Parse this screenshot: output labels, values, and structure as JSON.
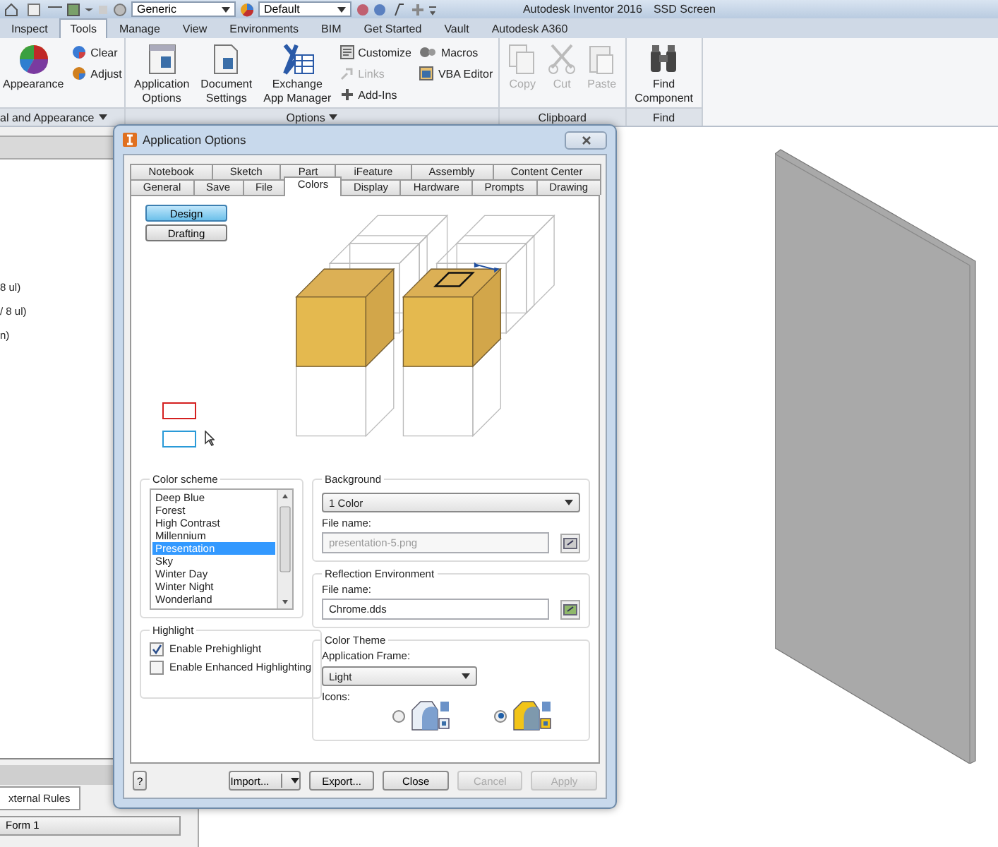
{
  "title_bar": {
    "style_dropdown": "Generic",
    "material_dropdown": "Default",
    "app_title": "Autodesk Inventor 2016",
    "document_title": "SSD Screen"
  },
  "ribbon": {
    "tabs": [
      {
        "label": "Inspect",
        "selected": false
      },
      {
        "label": "Tools",
        "selected": true
      },
      {
        "label": "Manage",
        "selected": false
      },
      {
        "label": "View",
        "selected": false
      },
      {
        "label": "Environments",
        "selected": false
      },
      {
        "label": "BIM",
        "selected": false
      },
      {
        "label": "Get Started",
        "selected": false
      },
      {
        "label": "Vault",
        "selected": false
      },
      {
        "label": "Autodesk A360",
        "selected": false
      }
    ],
    "groups": [
      {
        "label": "al and Appearance",
        "items": [
          {
            "kind": "large",
            "label": "Appearance",
            "disabled": false
          },
          {
            "kind": "small",
            "label": "Clear",
            "disabled": false
          },
          {
            "kind": "small",
            "label": "Adjust",
            "disabled": false
          }
        ]
      },
      {
        "label": "Options",
        "items": [
          {
            "kind": "large",
            "label": "Application\nOptions",
            "disabled": false
          },
          {
            "kind": "large",
            "label": "Document\nSettings",
            "disabled": false
          },
          {
            "kind": "large",
            "label": "Exchange\nApp Manager",
            "disabled": false
          },
          {
            "kind": "small",
            "label": "Customize",
            "disabled": false
          },
          {
            "kind": "small",
            "label": "Links",
            "disabled": true
          },
          {
            "kind": "small",
            "label": "Add-Ins",
            "disabled": false
          },
          {
            "kind": "small",
            "label": "Macros",
            "disabled": false
          },
          {
            "kind": "small",
            "label": "VBA Editor",
            "disabled": false
          }
        ]
      },
      {
        "label": "Clipboard",
        "items": [
          {
            "kind": "large",
            "label": "Copy",
            "disabled": true
          },
          {
            "kind": "large",
            "label": "Cut",
            "disabled": true
          },
          {
            "kind": "large",
            "label": "Paste",
            "disabled": true
          }
        ]
      },
      {
        "label": "Find",
        "items": [
          {
            "kind": "large",
            "label": "Find\nComponent",
            "disabled": false
          }
        ]
      }
    ]
  },
  "left_panel": {
    "lines": [
      "8 ul)",
      "/ 8 ul)",
      "n)"
    ],
    "tab": "xternal Rules",
    "button": "Form 1"
  },
  "dialog": {
    "title": "Application Options",
    "tab_rows": [
      [
        {
          "label": "Notebook",
          "selected": false
        },
        {
          "label": "Sketch",
          "selected": false
        },
        {
          "label": "Part",
          "selected": false
        },
        {
          "label": "iFeature",
          "selected": false
        },
        {
          "label": "Assembly",
          "selected": false
        },
        {
          "label": "Content Center",
          "selected": false
        }
      ],
      [
        {
          "label": "General",
          "selected": false
        },
        {
          "label": "Save",
          "selected": false
        },
        {
          "label": "File",
          "selected": false
        },
        {
          "label": "Colors",
          "selected": true
        },
        {
          "label": "Display",
          "selected": false
        },
        {
          "label": "Hardware",
          "selected": false
        },
        {
          "label": "Prompts",
          "selected": false
        },
        {
          "label": "Drawing",
          "selected": false
        }
      ]
    ],
    "modes": [
      {
        "label": "Design",
        "selected": true
      },
      {
        "label": "Drafting",
        "selected": false
      }
    ],
    "color_scheme": {
      "title": "Color scheme",
      "items": [
        {
          "label": "Deep Blue",
          "selected": false
        },
        {
          "label": "Forest",
          "selected": false
        },
        {
          "label": "High Contrast",
          "selected": false
        },
        {
          "label": "Millennium",
          "selected": false
        },
        {
          "label": "Presentation",
          "selected": true
        },
        {
          "label": "Sky",
          "selected": false
        },
        {
          "label": "Winter Day",
          "selected": false
        },
        {
          "label": "Winter Night",
          "selected": false
        },
        {
          "label": "Wonderland",
          "selected": false
        }
      ]
    },
    "background": {
      "title": "Background",
      "dropdown": "1 Color",
      "file_label": "File name:",
      "file_value": "presentation-5.png",
      "file_disabled": true
    },
    "reflection": {
      "title": "Reflection Environment",
      "file_label": "File name:",
      "file_value": "Chrome.dds",
      "file_disabled": false
    },
    "highlight": {
      "title": "Highlight",
      "options": [
        {
          "label": "Enable Prehighlight",
          "checked": true
        },
        {
          "label": "Enable Enhanced Highlighting",
          "checked": false
        }
      ]
    },
    "color_theme": {
      "title": "Color Theme",
      "frame_label": "Application Frame:",
      "frame_dropdown": "Light",
      "icons_label": "Icons:",
      "icon_options": [
        {
          "kind": "blue",
          "selected": false
        },
        {
          "kind": "yellow",
          "selected": true
        }
      ]
    },
    "help": "?",
    "buttons": [
      {
        "label": "Import...",
        "kind": "split",
        "disabled": false
      },
      {
        "label": "Export...",
        "kind": "plain",
        "disabled": false
      },
      {
        "label": "Close",
        "kind": "plain",
        "disabled": false
      },
      {
        "label": "Cancel",
        "kind": "plain",
        "disabled": true
      },
      {
        "label": "Apply",
        "kind": "plain",
        "disabled": true
      }
    ]
  }
}
